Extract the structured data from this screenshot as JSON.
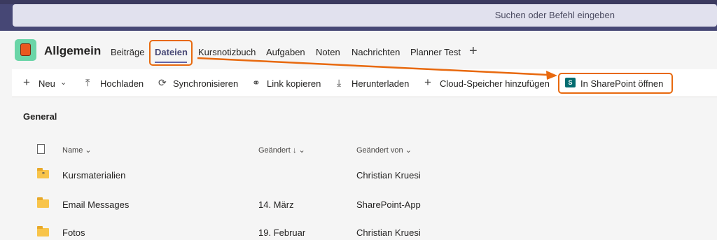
{
  "search": {
    "placeholder": "Suchen oder Befehl eingeben"
  },
  "team": {
    "name": "Allgemein"
  },
  "tabs": [
    {
      "label": "Beiträge"
    },
    {
      "label": "Dateien"
    },
    {
      "label": "Kursnotizbuch"
    },
    {
      "label": "Aufgaben"
    },
    {
      "label": "Noten"
    },
    {
      "label": "Nachrichten"
    },
    {
      "label": "Planner Test"
    }
  ],
  "add_tab_icon": "plus-icon",
  "toolbar": {
    "new": "Neu",
    "upload": "Hochladen",
    "sync": "Synchronisieren",
    "copy_link": "Link kopieren",
    "download": "Herunterladen",
    "cloud": "Cloud-Speicher hinzufügen",
    "sharepoint": "In SharePoint öffnen"
  },
  "section": {
    "title": "General"
  },
  "columns": {
    "name": "Name",
    "modified": "Geändert",
    "modified_by": "Geändert von"
  },
  "files": [
    {
      "name": "Kursmaterialien",
      "modified": "",
      "modified_by": "Christian Kruesi"
    },
    {
      "name": "Email Messages",
      "modified": "14. März",
      "modified_by": "SharePoint-App"
    },
    {
      "name": "Fotos",
      "modified": "19. Februar",
      "modified_by": "Christian Kruesi"
    }
  ],
  "colors": {
    "accent": "#6264a7",
    "callout": "#e8690e",
    "topbar": "#464775"
  }
}
